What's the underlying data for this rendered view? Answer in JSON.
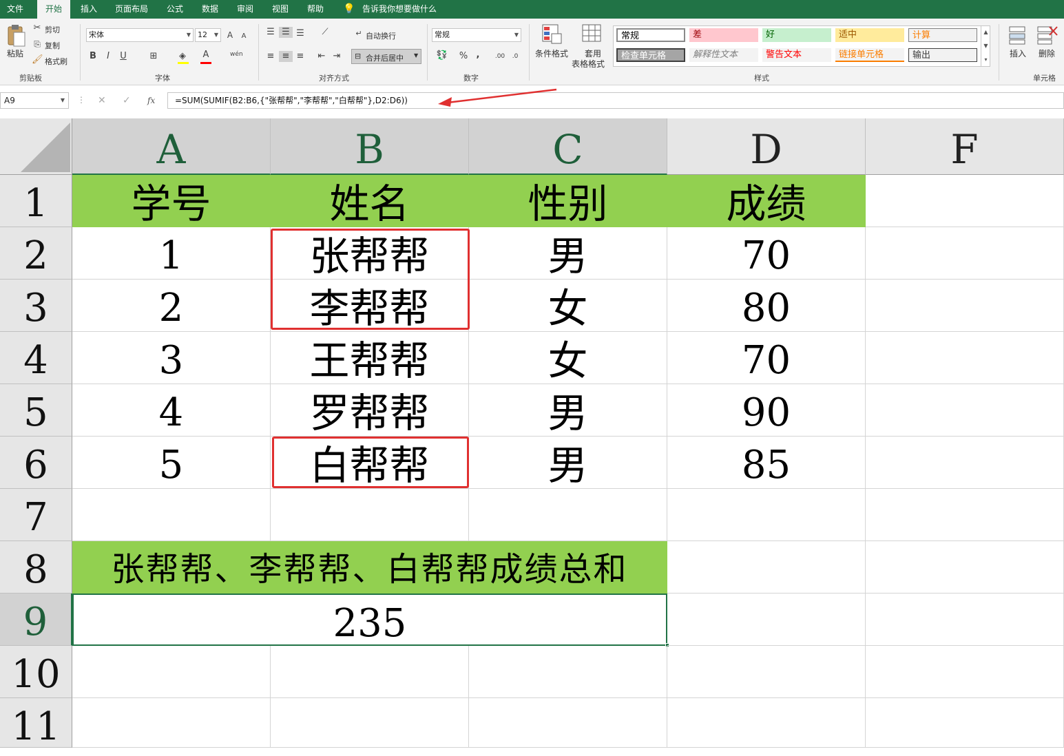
{
  "menu": {
    "tabs": [
      "文件",
      "开始",
      "插入",
      "页面布局",
      "公式",
      "数据",
      "审阅",
      "视图",
      "帮助"
    ],
    "tell_me": "告诉我你想要做什么"
  },
  "ribbon": {
    "clipboard": {
      "paste": "粘贴",
      "cut": "剪切",
      "copy": "复制",
      "format_painter": "格式刷",
      "group": "剪贴板"
    },
    "font": {
      "name": "宋体",
      "size": "12",
      "bold": "B",
      "italic": "I",
      "underline": "U",
      "grow": "A",
      "shrink": "A",
      "font_color": "A",
      "phonetic": "wén",
      "group": "字体"
    },
    "alignment": {
      "wrap": "自动换行",
      "merge": "合并后居中",
      "group": "对齐方式"
    },
    "number": {
      "format": "常规",
      "percent": "%",
      "comma": ",",
      "inc_dec": ".00",
      "dec_dec": ".0",
      "group": "数字"
    },
    "styles": {
      "conditional": "条件格式",
      "table_format_1": "套用",
      "table_format_2": "表格格式",
      "group": "样式",
      "gallery": [
        {
          "label": "常规",
          "bg": "#ffffff",
          "color": "#000000"
        },
        {
          "label": "差",
          "bg": "#ffc7ce",
          "color": "#9c0006"
        },
        {
          "label": "好",
          "bg": "#c6efce",
          "color": "#006100"
        },
        {
          "label": "适中",
          "bg": "#ffeb9c",
          "color": "#9c5700"
        },
        {
          "label": "计算",
          "bg": "#f2f2f2",
          "color": "#fa7d00"
        },
        {
          "label": "检查单元格",
          "bg": "#a5a5a5",
          "color": "#ffffff"
        },
        {
          "label": "解释性文本",
          "bg": "#f3f3f3",
          "color": "#7f7f7f"
        },
        {
          "label": "警告文本",
          "bg": "#f3f3f3",
          "color": "#ff0000"
        },
        {
          "label": "链接单元格",
          "bg": "#f3f3f3",
          "color": "#fa7d00"
        },
        {
          "label": "输出",
          "bg": "#f2f2f2",
          "color": "#3f3f3f"
        }
      ]
    },
    "cells": {
      "insert": "插入",
      "delete": "删除",
      "group": "单元格"
    }
  },
  "formula_bar": {
    "name_box": "A9",
    "fx": "fx",
    "formula": "=SUM(SUMIF(B2:B6,{\"张帮帮\",\"李帮帮\",\"白帮帮\"},D2:D6))"
  },
  "sheet": {
    "columns": [
      "A",
      "B",
      "C",
      "D",
      "F"
    ],
    "row_numbers": [
      "1",
      "2",
      "3",
      "4",
      "5",
      "6",
      "7",
      "8",
      "9",
      "10",
      "11"
    ],
    "headers": [
      "学号",
      "姓名",
      "性别",
      "成绩"
    ],
    "rows": [
      [
        "1",
        "张帮帮",
        "男",
        "70"
      ],
      [
        "2",
        "李帮帮",
        "女",
        "80"
      ],
      [
        "3",
        "王帮帮",
        "女",
        "70"
      ],
      [
        "4",
        "罗帮帮",
        "男",
        "90"
      ],
      [
        "5",
        "白帮帮",
        "男",
        "85"
      ]
    ],
    "summary_label": "张帮帮、李帮帮、白帮帮成绩总和",
    "summary_value": "235"
  },
  "colors": {
    "excel_green": "#217346",
    "header_fill": "#92d050",
    "annotation_red": "#e03030"
  }
}
